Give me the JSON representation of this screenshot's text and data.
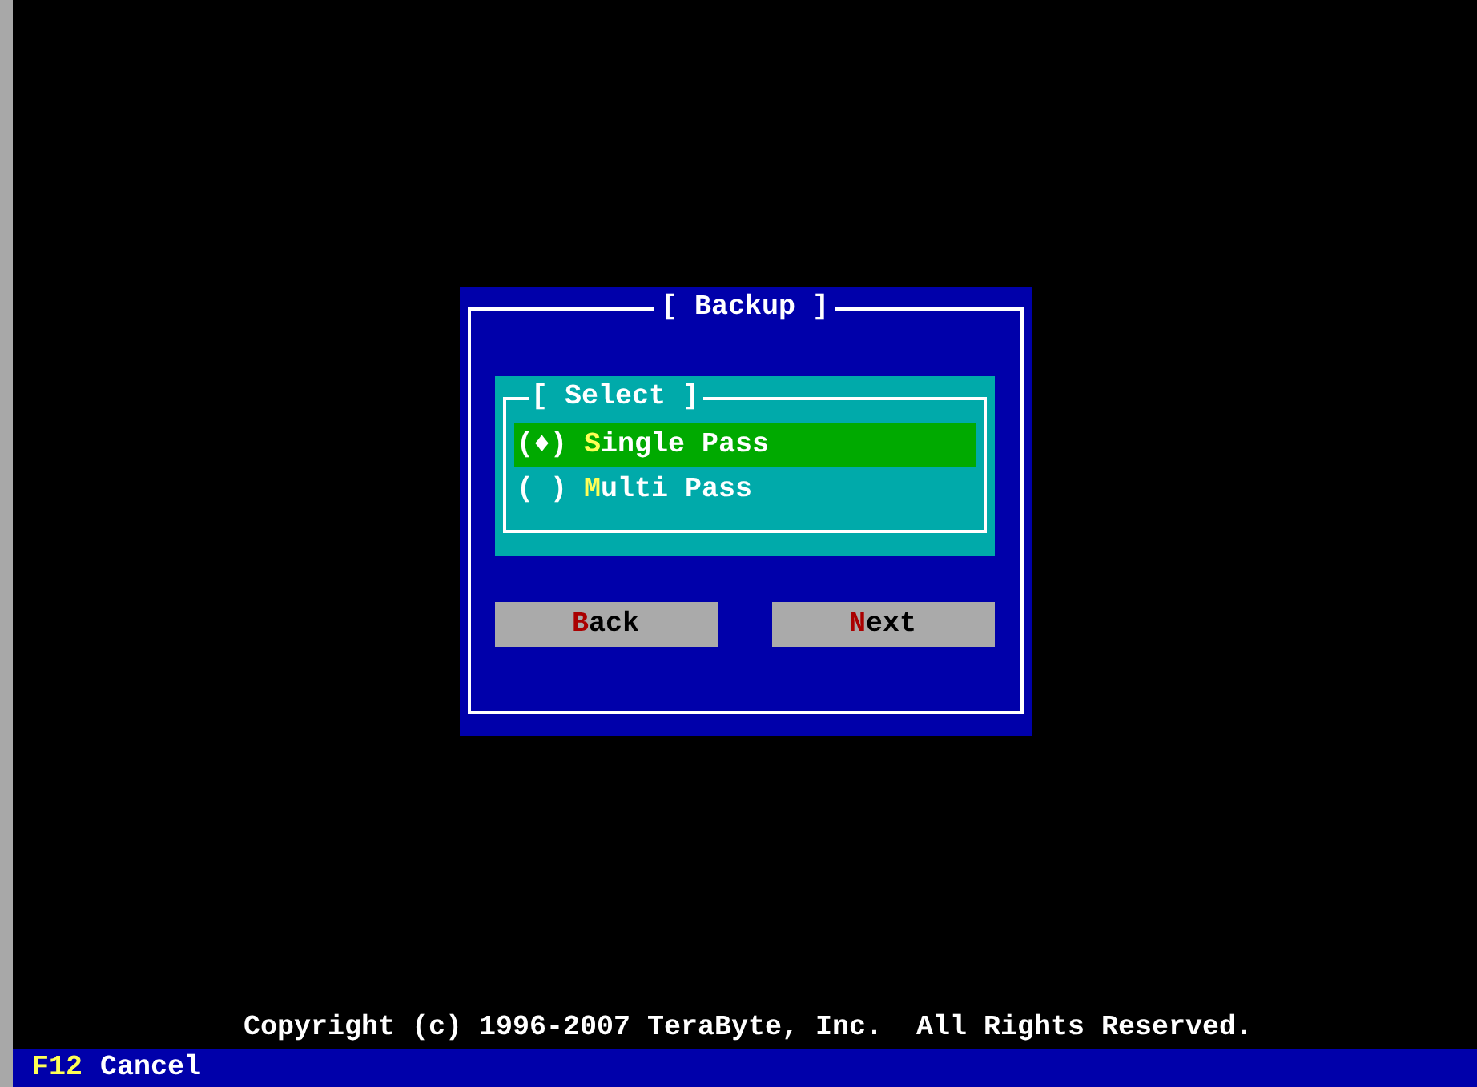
{
  "dialog": {
    "title": "[ Backup ]",
    "group": {
      "title": "[ Select ]",
      "options": [
        {
          "radio": "(♦)",
          "hotkey": "S",
          "label_rest": "ingle Pass",
          "selected": true
        },
        {
          "radio": "( )",
          "hotkey": "M",
          "label_rest": "ulti Pass",
          "selected": false
        }
      ]
    },
    "buttons": [
      {
        "hotkey": "B",
        "label_rest": "ack"
      },
      {
        "hotkey": "N",
        "label_rest": "ext"
      }
    ]
  },
  "copyright": "Copyright (c) 1996-2007 TeraByte, Inc.  All Rights Reserved.",
  "status_bar": {
    "key": "F12",
    "action": "Cancel"
  }
}
